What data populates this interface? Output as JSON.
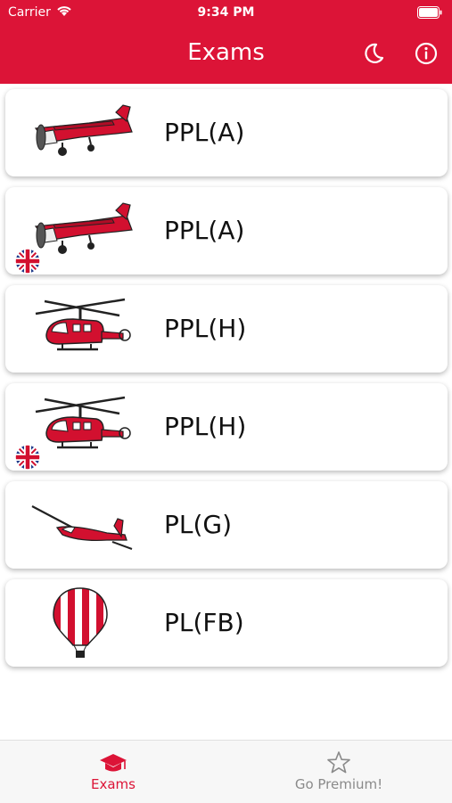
{
  "status_bar": {
    "carrier": "Carrier",
    "time": "9:34 PM"
  },
  "header": {
    "title": "Exams",
    "icons": [
      "moon-icon",
      "info-icon"
    ]
  },
  "exams": [
    {
      "label": "PPL(A)",
      "icon": "airplane-icon",
      "flag": false
    },
    {
      "label": "PPL(A)",
      "icon": "airplane-icon",
      "flag": true
    },
    {
      "label": "PPL(H)",
      "icon": "helicopter-icon",
      "flag": false
    },
    {
      "label": "PPL(H)",
      "icon": "helicopter-icon",
      "flag": true
    },
    {
      "label": "PL(G)",
      "icon": "glider-icon",
      "flag": false
    },
    {
      "label": "PL(FB)",
      "icon": "balloon-icon",
      "flag": false
    }
  ],
  "tabs": {
    "exams": "Exams",
    "premium": "Go Premium!"
  },
  "colors": {
    "brand": "#dc1437",
    "tab_active": "#dc1437",
    "tab_inactive": "#8a8a8a"
  }
}
